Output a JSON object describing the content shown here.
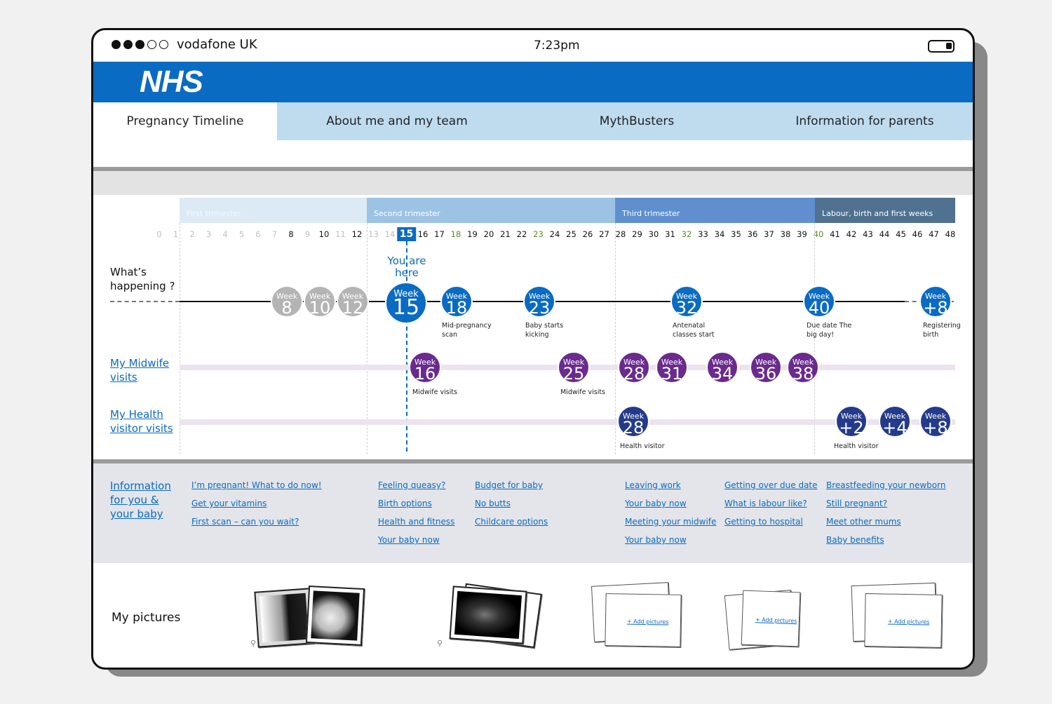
{
  "status": {
    "carrier": "vodafone UK",
    "time": "7:23pm"
  },
  "header": {
    "logo": "NHS"
  },
  "tabs": [
    "Pregnancy Timeline",
    "About me and my team",
    "MythBusters",
    "Information for parents"
  ],
  "trimesters": [
    "First trimester",
    "Second trimester",
    "Third trimester",
    "Labour, birth and first weeks"
  ],
  "weeks": [
    "0",
    "1",
    "2",
    "3",
    "4",
    "5",
    "6",
    "7",
    "8",
    "9",
    "10",
    "11",
    "12",
    "13",
    "14",
    "15",
    "16",
    "17",
    "18",
    "19",
    "20",
    "21",
    "22",
    "23",
    "24",
    "25",
    "26",
    "27",
    "28",
    "29",
    "30",
    "31",
    "32",
    "33",
    "34",
    "35",
    "36",
    "37",
    "38",
    "39",
    "40",
    "41",
    "42",
    "43",
    "44",
    "45",
    "46",
    "47",
    "48"
  ],
  "current_week": "15",
  "you_are_here": "You are here",
  "rows": {
    "happening": "What’s happening ?",
    "midwife": "My Midwife visits",
    "health": "My Health visitor visits"
  },
  "bubble_word": "Week",
  "happening": {
    "past": [
      "8",
      "10",
      "12"
    ],
    "current": "15",
    "future": [
      "18",
      "23",
      "32",
      "40",
      "+8"
    ],
    "captions": {
      "c18": "Mid-pregnancy scan",
      "c23": "Baby starts kicking",
      "c32": "Antenatal classes start",
      "c40": "Due date The big day!",
      "c48": "Registering birth"
    }
  },
  "midwife": {
    "weeks": [
      "16",
      "25",
      "28",
      "31",
      "34",
      "36",
      "38"
    ],
    "caption": "Midwife visits"
  },
  "health_visitor": {
    "weeks": [
      "28",
      "+2",
      "+4",
      "+8"
    ],
    "caption": "Health visitor"
  },
  "info": {
    "title": "Information for you & your baby",
    "col1": [
      "I’m pregnant! What to do now!",
      "Get your vitamins",
      "First scan – can you wait?"
    ],
    "col2": [
      "Feeling queasy?",
      "Birth options",
      "Health and fitness",
      "Your baby now"
    ],
    "col3": [
      "Budget for baby",
      "No butts",
      "Childcare options"
    ],
    "col4": [
      "Leaving work",
      "Your baby now",
      "Meeting your midwife",
      "Your baby now"
    ],
    "col5": [
      "Getting over due date",
      "What is labour like?",
      "Getting to hospital"
    ],
    "col6": [
      "Breastfeeding your newborn",
      "Still pregnant?",
      "Meet other mums",
      "Baby benefits"
    ]
  },
  "pictures": {
    "title": "My pictures",
    "add_label": "+ Add pictures"
  },
  "colors": {
    "nhs_blue": "#0a6bc2",
    "tab_bg": "#bfdcef",
    "midwife_purple": "#6a2a8e",
    "health_navy": "#243b8b",
    "past_gray": "#b4b4b4"
  },
  "icons": {
    "zoom": "magnifier-icon",
    "battery": "battery-icon",
    "signal": "signal-dots-icon"
  }
}
